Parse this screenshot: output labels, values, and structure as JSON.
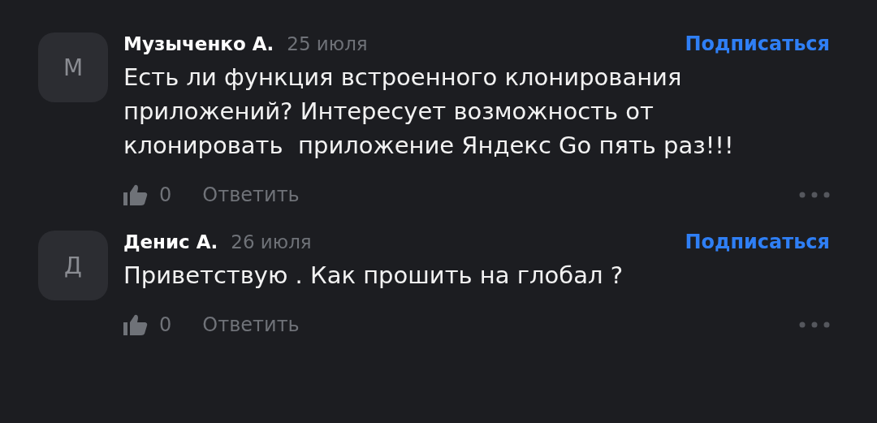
{
  "comments": [
    {
      "avatar": "М",
      "author": "Музыченко А.",
      "date": "25 июля",
      "subscribe": "Подписаться",
      "text": "Есть ли функция встроенного клонирования приложений? Интересует возможность от клонировать  приложение Яндекс Go пять раз!!!",
      "likes": "0",
      "reply": "Ответить"
    },
    {
      "avatar": "Д",
      "author": "Денис А.",
      "date": "26 июля",
      "subscribe": "Подписаться",
      "text": "Приветствую . Как прошить на глобал ?",
      "likes": "0",
      "reply": "Ответить"
    }
  ]
}
